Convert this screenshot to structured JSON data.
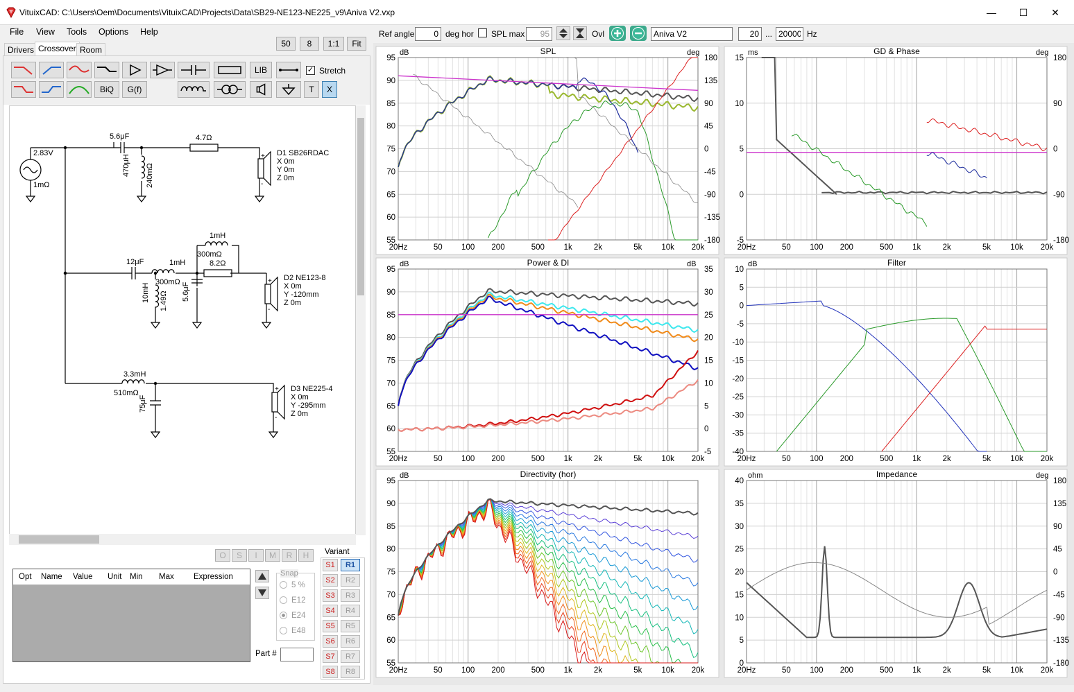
{
  "title": "VituixCAD: C:\\Users\\Oem\\Documents\\VituixCAD\\Projects\\Data\\SB29-NE123-NE225_v9\\Aniva V2.vxp",
  "window_controls": {
    "minimize": "—",
    "maximize": "☐",
    "close": "✕"
  },
  "menu": [
    "File",
    "View",
    "Tools",
    "Options",
    "Help"
  ],
  "zoom_buttons": [
    "50",
    "8",
    "1:1",
    "Fit"
  ],
  "tabs": [
    "Drivers",
    "Crossover",
    "Room"
  ],
  "toolbar": {
    "biq": "BiQ",
    "gf": "G(f)",
    "lib": "LIB",
    "stretch": "Stretch",
    "t": "T",
    "x": "X"
  },
  "schematic": {
    "source_v": "2.83V",
    "source_r": "1mΩ",
    "c1": "5.6μF",
    "r1": "4.7Ω",
    "l1": "470μH",
    "l1r": "240mΩ",
    "d1": {
      "name": "D1 SB26RDAC",
      "x": "X 0m",
      "y": "Y 0m",
      "z": "Z 0m"
    },
    "l_top": "1mH",
    "l_top_r": "300mΩ",
    "r_mid": "8.2Ω",
    "c2": "12μF",
    "l2": "1mH",
    "l2r": "300mΩ",
    "l3": "10mH",
    "l3r": "1.49Ω",
    "c3": "5.6μF",
    "d2": {
      "name": "D2 NE123-8",
      "x": "X 0m",
      "y": "Y -120mm",
      "z": "Z 0m"
    },
    "l4": "3.3mH",
    "l4r": "510mΩ",
    "c4": "75μF",
    "d3": {
      "name": "D3 NE225-4",
      "x": "X 0m",
      "y": "Y -295mm",
      "z": "Z 0m"
    }
  },
  "opt_buttons": [
    "O",
    "S",
    "I",
    "M",
    "R",
    "H"
  ],
  "table_headers": [
    "Opt",
    "Name",
    "Value",
    "Unit",
    "Min",
    "Max",
    "Expression"
  ],
  "snap": {
    "label": "Snap",
    "options": [
      "5 %",
      "E12",
      "E24",
      "E48"
    ],
    "selected": "E24"
  },
  "part_label": "Part #",
  "variant": {
    "label": "Variant",
    "s": [
      "S1",
      "S2",
      "S3",
      "S4",
      "S5",
      "S6",
      "S7",
      "S8"
    ],
    "r": [
      "R1",
      "R2",
      "R3",
      "R4",
      "R5",
      "R6",
      "R7",
      "R8"
    ],
    "selected": "R1"
  },
  "controls": {
    "ref_angle_label": "Ref angle",
    "ref_angle": "0",
    "deg_hor": "deg hor",
    "spl_max_label": "SPL max",
    "spl_max": "95",
    "ovl": "Ovl",
    "name": "Aniva V2",
    "f_min": "20",
    "dots": "...",
    "f_max": "20000",
    "hz": "Hz"
  },
  "freq_ticks": [
    "20Hz",
    "50",
    "100",
    "200",
    "500",
    "1k",
    "2k",
    "5k",
    "10k",
    "20k"
  ],
  "charts": {
    "spl": {
      "title": "SPL",
      "left_unit": "dB",
      "right_unit": "deg",
      "left": [
        "95",
        "90",
        "85",
        "80",
        "75",
        "70",
        "65",
        "60",
        "55"
      ],
      "right": [
        "180",
        "135",
        "90",
        "45",
        "0",
        "-45",
        "-90",
        "-135",
        "-180"
      ]
    },
    "gd": {
      "title": "GD & Phase",
      "left_unit": "ms",
      "right_unit": "deg",
      "left": [
        "15",
        "10",
        "5",
        "0",
        "-5"
      ],
      "right": [
        "180",
        "90",
        "0",
        "-90",
        "-180"
      ]
    },
    "power": {
      "title": "Power & DI",
      "left_unit": "dB",
      "right_unit": "dB",
      "left": [
        "95",
        "90",
        "85",
        "80",
        "75",
        "70",
        "65",
        "60",
        "55"
      ],
      "right": [
        "35",
        "30",
        "25",
        "20",
        "15",
        "10",
        "5",
        "0",
        "-5"
      ]
    },
    "filter": {
      "title": "Filter",
      "left_unit": "dB",
      "left": [
        "10",
        "5",
        "0",
        "-5",
        "-10",
        "-15",
        "-20",
        "-25",
        "-30",
        "-35",
        "-40"
      ]
    },
    "dir": {
      "title": "Directivity (hor)",
      "left_unit": "dB",
      "left": [
        "95",
        "90",
        "85",
        "80",
        "75",
        "70",
        "65",
        "60",
        "55"
      ]
    },
    "imp": {
      "title": "Impedance",
      "left_unit": "ohm",
      "right_unit": "deg",
      "left": [
        "40",
        "35",
        "30",
        "25",
        "20",
        "15",
        "10",
        "5",
        "0"
      ],
      "right": [
        "180",
        "135",
        "90",
        "45",
        "0",
        "-45",
        "-90",
        "-135",
        "-180"
      ]
    }
  }
}
